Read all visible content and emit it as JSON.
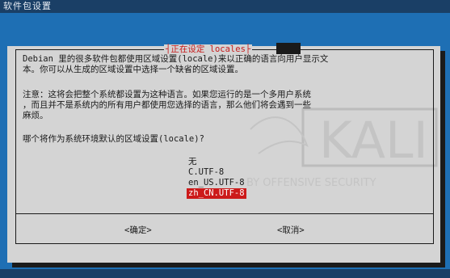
{
  "window": {
    "title": "软件包设置"
  },
  "dialog": {
    "title": "正在设定 locales",
    "paragraph1": [
      "Debian 里的很多软件包都使用区域设置(locale)来以正确的语言向用户显示文",
      "本。你可以从生成的区域设置中选择一个缺省的区域设置。"
    ],
    "paragraph2": [
      "注意：这将会把整个系统都设置为这种语言。如果您运行的是一个多用户系统",
      "，而且并不是系统内的所有用户都使用您选择的语言，那么他们将会遇到一些",
      "麻烦。"
    ],
    "question": "哪个将作为系统环境默认的区域设置(locale)?",
    "options": [
      "无",
      "C.UTF-8",
      "en_US.UTF-8",
      "zh_CN.UTF-8"
    ],
    "selected_index": 3,
    "ok_label": "<确定>",
    "cancel_label": "<取消>"
  },
  "colors": {
    "background": "#1e6fb4",
    "dialog": "#d4d4d4",
    "title_text": "#c61a1a",
    "selection": "#cc1a1a"
  }
}
